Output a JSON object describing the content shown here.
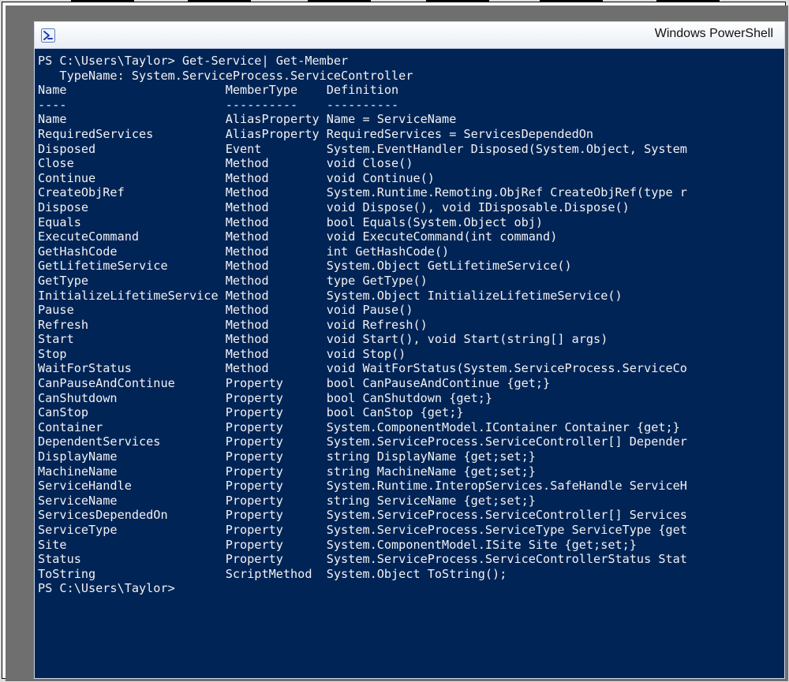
{
  "window": {
    "title": "Windows PowerShell"
  },
  "prompt1": "PS C:\\Users\\Taylor> ",
  "command1": "Get-Service| Get-Member",
  "typename_label": "   TypeName: ",
  "typename": "System.ServiceProcess.ServiceController",
  "header": {
    "name": "Name",
    "membertype": "MemberType",
    "definition": "Definition"
  },
  "rule": {
    "name": "----",
    "membertype": "----------",
    "definition": "----------"
  },
  "members": [
    {
      "name": "Name",
      "membertype": "AliasProperty",
      "definition": "Name = ServiceName"
    },
    {
      "name": "RequiredServices",
      "membertype": "AliasProperty",
      "definition": "RequiredServices = ServicesDependedOn"
    },
    {
      "name": "Disposed",
      "membertype": "Event",
      "definition": "System.EventHandler Disposed(System.Object, System"
    },
    {
      "name": "Close",
      "membertype": "Method",
      "definition": "void Close()"
    },
    {
      "name": "Continue",
      "membertype": "Method",
      "definition": "void Continue()"
    },
    {
      "name": "CreateObjRef",
      "membertype": "Method",
      "definition": "System.Runtime.Remoting.ObjRef CreateObjRef(type r"
    },
    {
      "name": "Dispose",
      "membertype": "Method",
      "definition": "void Dispose(), void IDisposable.Dispose()"
    },
    {
      "name": "Equals",
      "membertype": "Method",
      "definition": "bool Equals(System.Object obj)"
    },
    {
      "name": "ExecuteCommand",
      "membertype": "Method",
      "definition": "void ExecuteCommand(int command)"
    },
    {
      "name": "GetHashCode",
      "membertype": "Method",
      "definition": "int GetHashCode()"
    },
    {
      "name": "GetLifetimeService",
      "membertype": "Method",
      "definition": "System.Object GetLifetimeService()"
    },
    {
      "name": "GetType",
      "membertype": "Method",
      "definition": "type GetType()"
    },
    {
      "name": "InitializeLifetimeService",
      "membertype": "Method",
      "definition": "System.Object InitializeLifetimeService()"
    },
    {
      "name": "Pause",
      "membertype": "Method",
      "definition": "void Pause()"
    },
    {
      "name": "Refresh",
      "membertype": "Method",
      "definition": "void Refresh()"
    },
    {
      "name": "Start",
      "membertype": "Method",
      "definition": "void Start(), void Start(string[] args)"
    },
    {
      "name": "Stop",
      "membertype": "Method",
      "definition": "void Stop()"
    },
    {
      "name": "WaitForStatus",
      "membertype": "Method",
      "definition": "void WaitForStatus(System.ServiceProcess.ServiceCo"
    },
    {
      "name": "CanPauseAndContinue",
      "membertype": "Property",
      "definition": "bool CanPauseAndContinue {get;}"
    },
    {
      "name": "CanShutdown",
      "membertype": "Property",
      "definition": "bool CanShutdown {get;}"
    },
    {
      "name": "CanStop",
      "membertype": "Property",
      "definition": "bool CanStop {get;}"
    },
    {
      "name": "Container",
      "membertype": "Property",
      "definition": "System.ComponentModel.IContainer Container {get;}"
    },
    {
      "name": "DependentServices",
      "membertype": "Property",
      "definition": "System.ServiceProcess.ServiceController[] Depender"
    },
    {
      "name": "DisplayName",
      "membertype": "Property",
      "definition": "string DisplayName {get;set;}"
    },
    {
      "name": "MachineName",
      "membertype": "Property",
      "definition": "string MachineName {get;set;}"
    },
    {
      "name": "ServiceHandle",
      "membertype": "Property",
      "definition": "System.Runtime.InteropServices.SafeHandle ServiceH"
    },
    {
      "name": "ServiceName",
      "membertype": "Property",
      "definition": "string ServiceName {get;set;}"
    },
    {
      "name": "ServicesDependedOn",
      "membertype": "Property",
      "definition": "System.ServiceProcess.ServiceController[] Services"
    },
    {
      "name": "ServiceType",
      "membertype": "Property",
      "definition": "System.ServiceProcess.ServiceType ServiceType {get"
    },
    {
      "name": "Site",
      "membertype": "Property",
      "definition": "System.ComponentModel.ISite Site {get;set;}"
    },
    {
      "name": "Status",
      "membertype": "Property",
      "definition": "System.ServiceProcess.ServiceControllerStatus Stat"
    },
    {
      "name": "ToString",
      "membertype": "ScriptMethod",
      "definition": "System.Object ToString();"
    }
  ],
  "prompt2": "PS C:\\Users\\Taylor>"
}
